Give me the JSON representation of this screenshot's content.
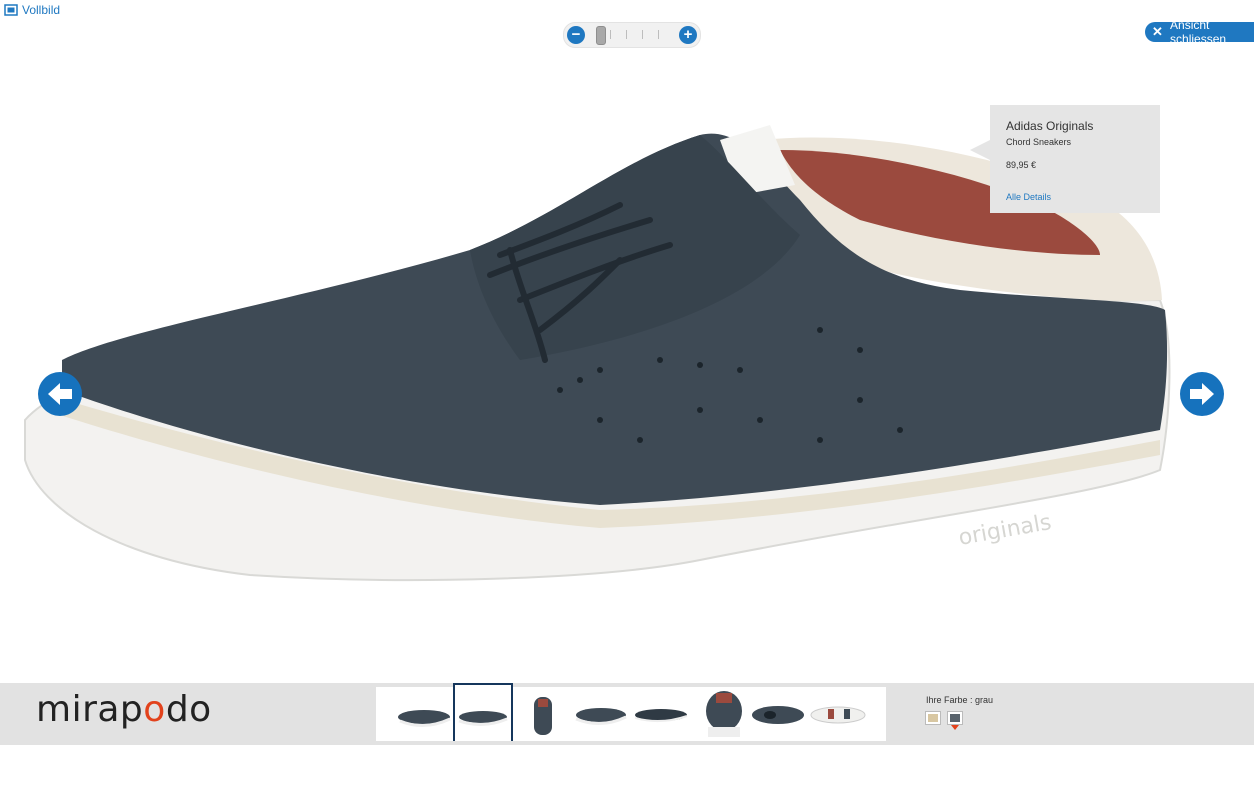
{
  "toolbar": {
    "fullscreen_label": "Vollbild",
    "close_label": "Ansicht schliessen"
  },
  "zoom": {
    "minus_label": "−",
    "plus_label": "+",
    "level_steps": 6,
    "current_step": 1
  },
  "product": {
    "brand": "Adidas Originals",
    "model": "Chord Sneakers",
    "price": "89,95 €",
    "details_link": "Alle Details",
    "sole_brand_mark": "originals"
  },
  "brand_logo": {
    "part1": "mirap",
    "o": "o",
    "part2": "do"
  },
  "color_selector": {
    "label": "Ihre Farbe : grau",
    "swatches": [
      {
        "name": "beige",
        "color": "#d8c7a2"
      },
      {
        "name": "grau",
        "color": "#58626b",
        "selected": true
      }
    ]
  },
  "thumbnails": [
    {
      "view": "side-left",
      "active": false
    },
    {
      "view": "side-right",
      "active": true
    },
    {
      "view": "heel",
      "active": false
    },
    {
      "view": "side-right-2",
      "active": false
    },
    {
      "view": "side-left-2",
      "active": false
    },
    {
      "view": "back",
      "active": false
    },
    {
      "view": "top",
      "active": false
    },
    {
      "view": "sole",
      "active": false
    }
  ],
  "colors": {
    "accent_blue": "#1f78c1",
    "suede_grey": "#3e4a55",
    "lining_red": "#9b4a3e",
    "bar_grey": "#e2e2e2"
  }
}
